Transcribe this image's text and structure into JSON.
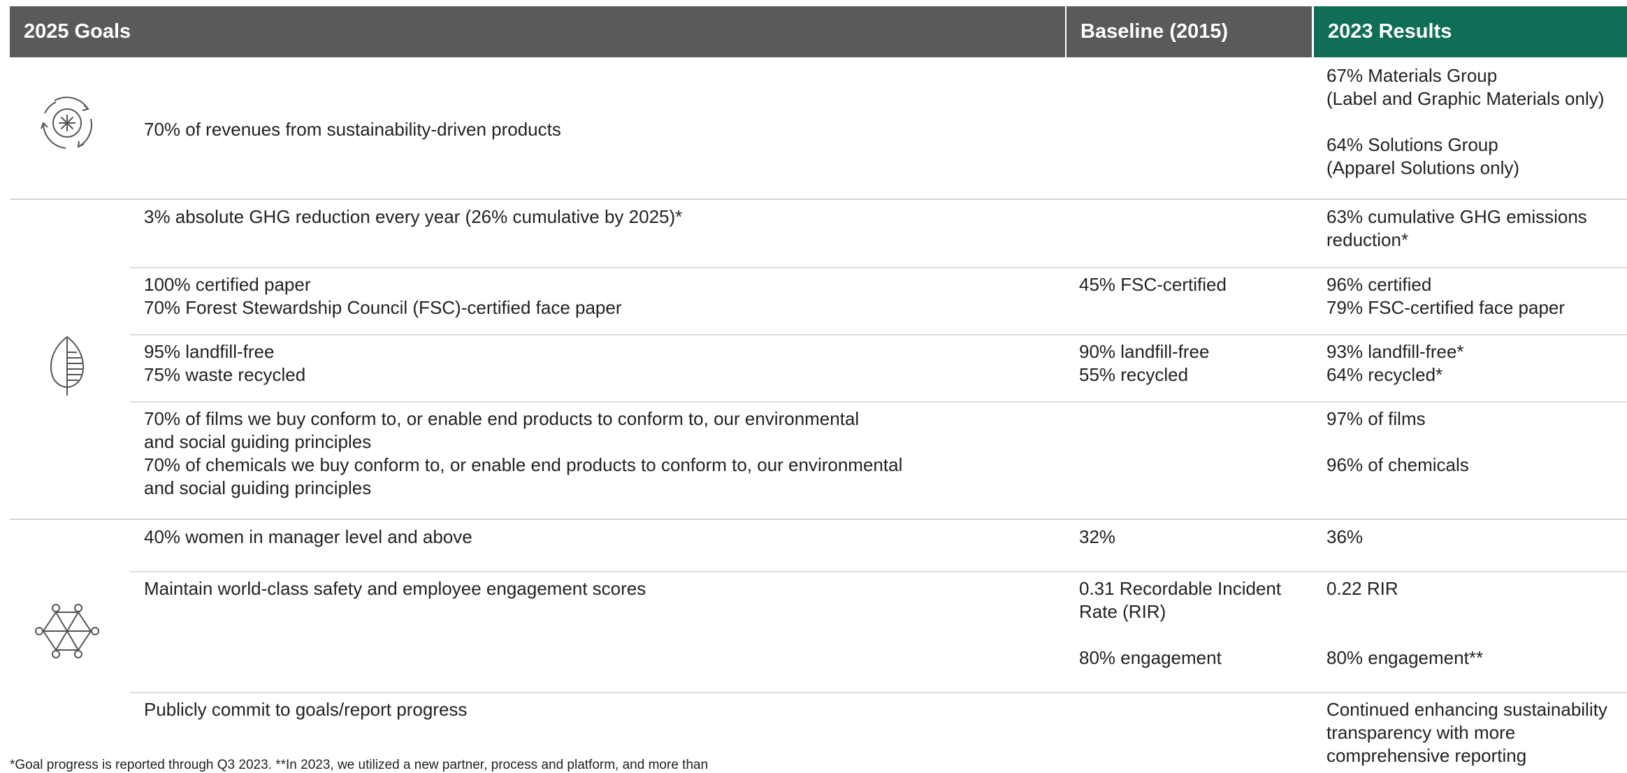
{
  "header": {
    "goals": "2025 Goals",
    "baseline": "Baseline (2015)",
    "results": "2023 Results"
  },
  "icons": {
    "circular": "circular-economy-icon",
    "leaf": "leaf-icon",
    "network": "people-network-icon"
  },
  "colors": {
    "header_gray": "#5a5a5c",
    "header_green": "#0f6e55"
  },
  "rows": [
    {
      "goal": [
        "70% of revenues from sustainability-driven products"
      ],
      "baseline": [],
      "results": [
        "67% Materials Group",
        "(Label and Graphic Materials only)",
        "",
        "64% Solutions Group",
        "(Apparel Solutions only)"
      ]
    },
    {
      "goal": [
        "3% absolute GHG reduction every year (26% cumulative by 2025)*"
      ],
      "baseline": [],
      "results": [
        "63% cumulative GHG emissions",
        "reduction*"
      ]
    },
    {
      "goal": [
        "100% certified paper",
        "70% Forest Stewardship Council (FSC)-certified face paper"
      ],
      "baseline": [
        "45% FSC-certified"
      ],
      "results": [
        "96% certified",
        "79% FSC-certified face paper"
      ]
    },
    {
      "goal": [
        "95% landfill-free",
        "75% waste recycled"
      ],
      "baseline": [
        "90% landfill-free",
        "55% recycled"
      ],
      "results": [
        "93% landfill-free*",
        "64% recycled*"
      ]
    },
    {
      "goal": [
        "70% of films we buy conform to, or enable end products to conform to, our environmental",
        "and social guiding principles",
        "70% of chemicals we buy conform to, or enable end products to conform to, our environmental",
        "and social guiding principles"
      ],
      "baseline": [],
      "results": [
        "97% of films",
        "",
        "96% of chemicals"
      ]
    },
    {
      "goal": [
        "40% women in manager level and above"
      ],
      "baseline": [
        "32%"
      ],
      "results": [
        "36%"
      ]
    },
    {
      "goal": [
        "Maintain world-class safety and employee engagement scores"
      ],
      "baseline": [
        "0.31 Recordable Incident",
        "Rate (RIR)",
        "",
        "80% engagement"
      ],
      "results": [
        "0.22 RIR",
        "",
        "",
        "80% engagement**"
      ]
    },
    {
      "goal": [
        "Publicly commit to goals/report progress"
      ],
      "baseline": [],
      "results": [
        "Continued enhancing sustainability",
        "transparency with more",
        "comprehensive reporting"
      ]
    }
  ],
  "footnote": "*Goal progress is reported through Q3 2023. **In 2023, we utilized a new partner, process and platform, and more than"
}
